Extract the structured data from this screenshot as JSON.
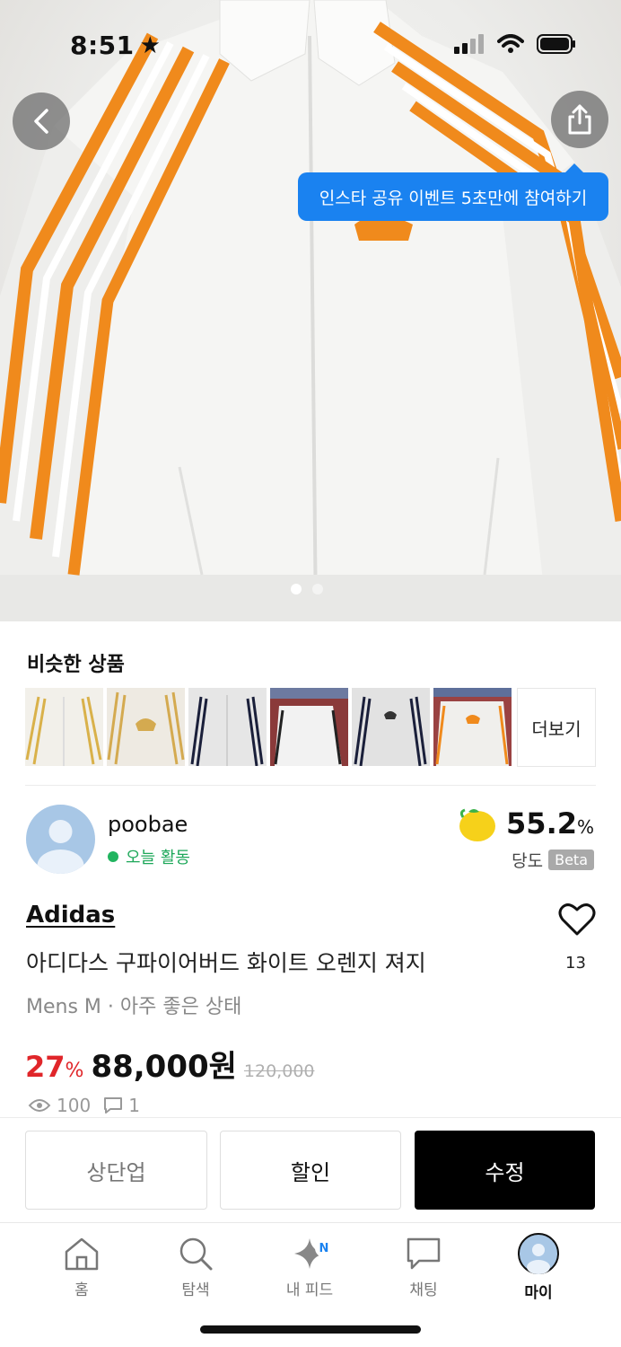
{
  "status": {
    "time": "8:51"
  },
  "tooltip": {
    "text": "인스타 공유 이벤트 5초만에 참여하기"
  },
  "similar": {
    "title": "비슷한 상품",
    "more": "더보기"
  },
  "seller": {
    "name": "poobae",
    "activity": "오늘 활동"
  },
  "sugar": {
    "value": "55.2",
    "unit": "%",
    "label": "당도",
    "badge": "Beta"
  },
  "product": {
    "brand": "Adidas",
    "title": "아디다스 구파이어버드 화이트 오렌지 져지",
    "condition": "Mens M · 아주 좋은 상태",
    "discount": "27",
    "discount_unit": "%",
    "price": "88,000원",
    "original_price": "120,000",
    "likes": "13",
    "views": "100",
    "chats": "1"
  },
  "actions": {
    "bump": "상단업",
    "discount": "할인",
    "edit": "수정"
  },
  "tabs": [
    {
      "label": "홈",
      "icon": "home-icon"
    },
    {
      "label": "탐색",
      "icon": "search-icon"
    },
    {
      "label": "내 피드",
      "icon": "sparkle-icon",
      "badge": "N"
    },
    {
      "label": "채팅",
      "icon": "chat-icon"
    },
    {
      "label": "마이",
      "icon": "profile-icon"
    }
  ],
  "colors": {
    "accent": "#1a82f0",
    "discount": "#e0262a",
    "online": "#21b45f",
    "stripe": "#f08a1c"
  }
}
